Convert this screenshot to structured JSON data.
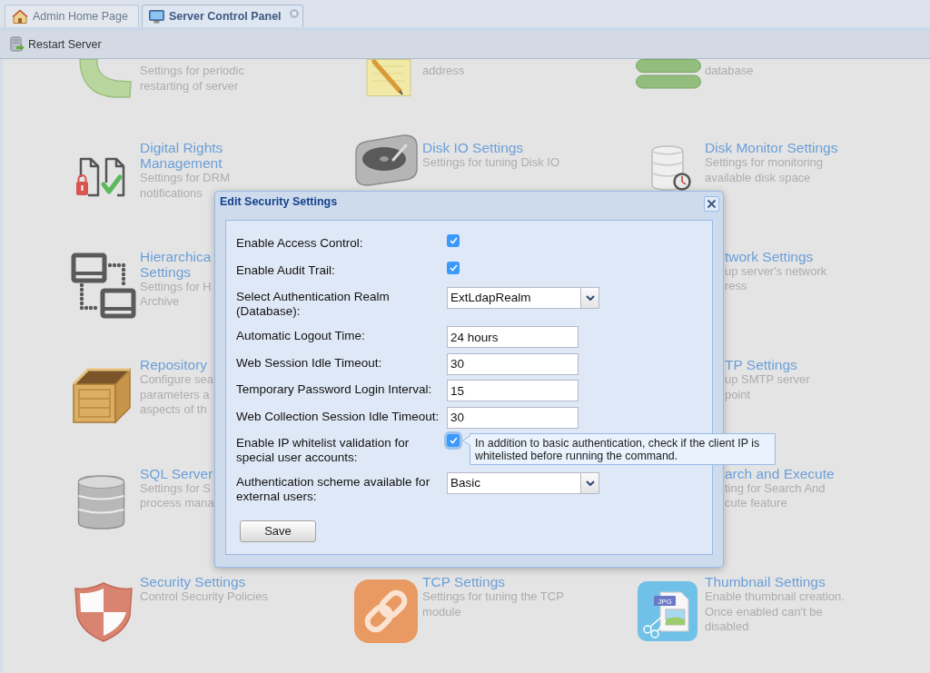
{
  "tabs": [
    {
      "label": "Admin Home Page",
      "selected": false,
      "closable": false
    },
    {
      "label": "Server Control Panel",
      "selected": true,
      "closable": true
    }
  ],
  "toolbar": {
    "buttons": [
      {
        "label": "Restart Server"
      }
    ]
  },
  "settings_grid": {
    "rows": [
      {
        "left": {
          "kind": "full",
          "description": "Settings for periodic restarting of server"
        },
        "middle": {
          "kind": "full",
          "description": "address"
        },
        "right": {
          "kind": "full",
          "description": "database"
        }
      },
      {
        "left": {
          "kind": "full",
          "title": "Digital Rights Management",
          "description": "Settings for DRM notifications"
        },
        "middle": {
          "kind": "full",
          "title": "Disk IO Settings",
          "description": "Settings for tuning Disk IO"
        },
        "right": {
          "kind": "full",
          "title": "Disk Monitor Settings",
          "description": "Settings for monitoring available disk space"
        }
      },
      {
        "left": {
          "kind": "full",
          "title": "Hierarchica\nSettings",
          "description": "Settings for H\nArchive"
        },
        "right": {
          "kind": "tail",
          "title": "twork Settings",
          "description": "up server's network\nress"
        }
      },
      {
        "left": {
          "kind": "full",
          "title": "Repository",
          "description": "Configure sea\nparameters a\naspects of th"
        },
        "right": {
          "kind": "tail",
          "title": "TP Settings",
          "description": "up SMTP server\npoint"
        }
      },
      {
        "left": {
          "kind": "full",
          "title": "SQL Server",
          "description": "Settings for S\nprocess mana"
        },
        "right": {
          "kind": "tail",
          "title": "arch and Execute",
          "description": "ting for Search And\ncute feature"
        }
      },
      {
        "left": {
          "kind": "full",
          "title": "Security Settings",
          "description": "Control Security Policies"
        },
        "middle": {
          "kind": "full",
          "title": "TCP Settings",
          "description": "Settings for tuning the TCP module"
        },
        "right": {
          "kind": "full",
          "title": "Thumbnail Settings",
          "description": "Enable thumbnail creation. Once enabled can't be disabled",
          "icon_label": "JPG"
        }
      }
    ]
  },
  "dialog": {
    "title": "Edit Security Settings",
    "fields": [
      {
        "kind": "checkbox",
        "label": "Enable Access Control:",
        "checked": true,
        "focused": false
      },
      {
        "kind": "checkbox",
        "label": "Enable Audit Trail:",
        "checked": true,
        "focused": false
      },
      {
        "kind": "select",
        "label": "Select Authentication Realm (Database):",
        "value": "ExtLdapRealm",
        "focused": false
      },
      {
        "kind": "text",
        "label": "Automatic Logout Time:",
        "value": "24 hours",
        "focused": false
      },
      {
        "kind": "text",
        "label": "Web Session Idle Timeout:",
        "value": "30",
        "focused": false
      },
      {
        "kind": "text",
        "label": "Temporary Password Login Interval:",
        "value": "15",
        "focused": false
      },
      {
        "kind": "text",
        "label": "Web Collection Session Idle Timeout:",
        "value": "30",
        "focused": false
      },
      {
        "kind": "checkbox",
        "label": "Enable IP whitelist validation for special user accounts:",
        "checked": true,
        "focused": true,
        "tooltip": "In addition to basic authentication, check if the client IP is whitelisted before running the command."
      },
      {
        "kind": "select",
        "label": "Authentication scheme available for external users:",
        "value": "Basic",
        "focused": false
      }
    ],
    "buttons": [
      {
        "label": "Save"
      }
    ]
  }
}
